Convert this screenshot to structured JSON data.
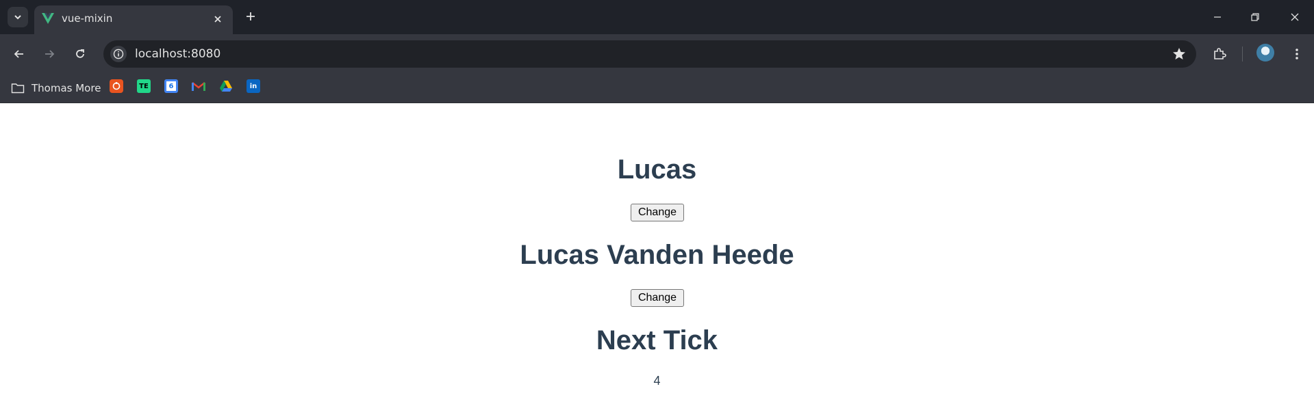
{
  "browser": {
    "tab": {
      "title": "vue-mixin",
      "favicon": "vue-logo-icon"
    },
    "address": {
      "url": "localhost:8080"
    },
    "bookmarks": {
      "folder_label": "Thomas More",
      "icons": [
        "ubuntu-icon",
        "te-icon",
        "google-calendar-icon",
        "gmail-icon",
        "google-drive-icon",
        "linkedin-icon"
      ],
      "te_text": "TE",
      "calendar_text": "6",
      "linkedin_text": "in"
    }
  },
  "page": {
    "first_name": "Lucas",
    "change_label_1": "Change",
    "full_name": "Lucas Vanden Heede",
    "change_label_2": "Change",
    "next_tick_title": "Next Tick",
    "next_tick_count": "4"
  },
  "colors": {
    "heading": "#2c3e50",
    "tabstrip_bg": "#1f2229",
    "toolbar_bg": "#35373f",
    "omnibox_bg": "#202227"
  }
}
